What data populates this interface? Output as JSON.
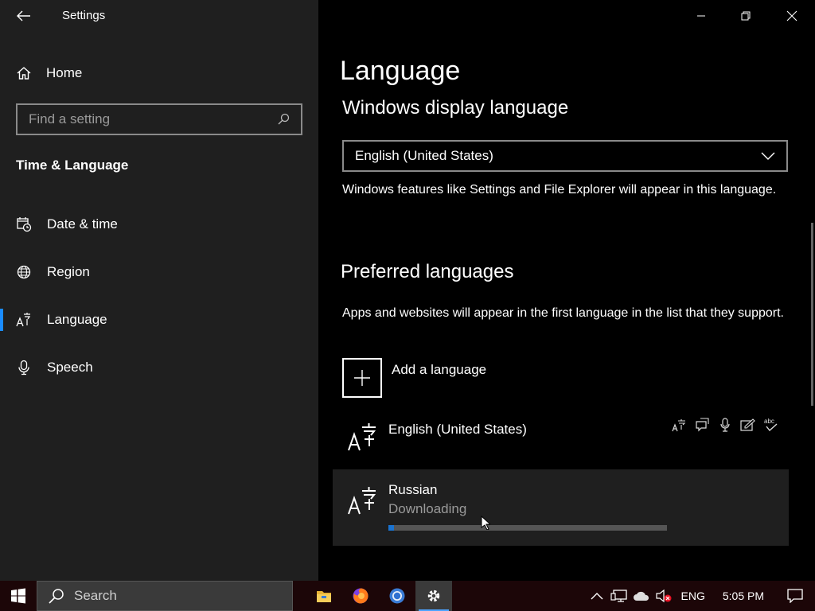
{
  "window": {
    "title": "Settings"
  },
  "sidebar": {
    "home_label": "Home",
    "search_placeholder": "Find a setting",
    "section_title": "Time & Language",
    "items": [
      {
        "label": "Date & time",
        "icon": "calendar-clock-icon"
      },
      {
        "label": "Region",
        "icon": "globe-icon"
      },
      {
        "label": "Language",
        "icon": "language-icon",
        "active": true
      },
      {
        "label": "Speech",
        "icon": "microphone-icon"
      }
    ]
  },
  "main": {
    "page_title": "Language",
    "display_language": {
      "heading": "Windows display language",
      "selected": "English (United States)",
      "description": "Windows features like Settings and File Explorer will appear in this language."
    },
    "preferred": {
      "heading": "Preferred languages",
      "description": "Apps and websites will appear in the first language in the list that they support.",
      "add_label": "Add a language",
      "languages": [
        {
          "name": "English (United States)",
          "features": [
            "language-pack-icon",
            "speech-recognition-icon",
            "text-to-speech-icon",
            "handwriting-icon",
            "spell-check-icon"
          ]
        },
        {
          "name": "Russian",
          "status": "Downloading",
          "progress": 0.02
        }
      ],
      "feature_abc": "abc"
    }
  },
  "taskbar": {
    "search_placeholder": "Search",
    "apps": [
      "file-explorer-icon",
      "firefox-icon",
      "chrome-icon",
      "settings-icon"
    ],
    "input_language": "ENG",
    "time": "5:05 PM"
  },
  "colors": {
    "accent": "#1a8cff",
    "sidebar_bg": "#1f1f1f",
    "main_bg": "#000000",
    "progress_fill": "#1a73d0"
  }
}
